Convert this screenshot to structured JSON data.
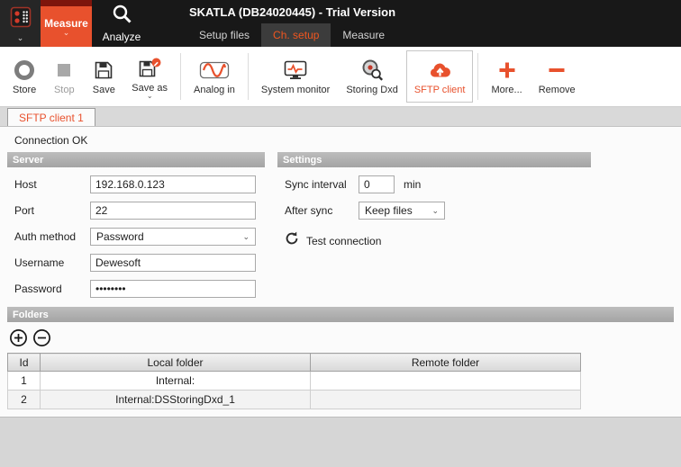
{
  "window": {
    "title": "SKATLA (DB24020445) - Trial Version"
  },
  "topbar": {
    "measure_label": "Measure",
    "analyze_label": "Analyze",
    "tabs": [
      {
        "label": "Setup files"
      },
      {
        "label": "Ch. setup"
      },
      {
        "label": "Measure"
      }
    ]
  },
  "toolbar": {
    "store": "Store",
    "stop": "Stop",
    "save": "Save",
    "save_as": "Save as",
    "analog_in": "Analog in",
    "system_monitor": "System monitor",
    "storing_dxd": "Storing Dxd",
    "sftp_client": "SFTP client",
    "more": "More...",
    "remove": "Remove"
  },
  "plugin_tab": {
    "label": "SFTP client 1"
  },
  "status": {
    "connection": "Connection OK"
  },
  "server": {
    "header": "Server",
    "fields": [
      {
        "label": "Host",
        "value": "192.168.0.123"
      },
      {
        "label": "Port",
        "value": "22"
      },
      {
        "label": "Auth method",
        "value": "Password"
      },
      {
        "label": "Username",
        "value": "Dewesoft"
      },
      {
        "label": "Password",
        "value": "••••••••"
      }
    ]
  },
  "settings": {
    "header": "Settings",
    "sync_interval": {
      "label": "Sync interval",
      "value": "0",
      "unit": "min"
    },
    "after_sync": {
      "label": "After sync",
      "value": "Keep files"
    },
    "test_connection": {
      "label": "Test connection"
    }
  },
  "folders": {
    "header": "Folders",
    "columns": [
      "Id",
      "Local folder",
      "Remote folder"
    ],
    "rows": [
      {
        "id": "1",
        "local": "Internal:",
        "remote": ""
      },
      {
        "id": "2",
        "local": "Internal:DSStoringDxd_1",
        "remote": ""
      }
    ]
  },
  "colors": {
    "accent": "#e8512d",
    "topbar": "#181818"
  }
}
